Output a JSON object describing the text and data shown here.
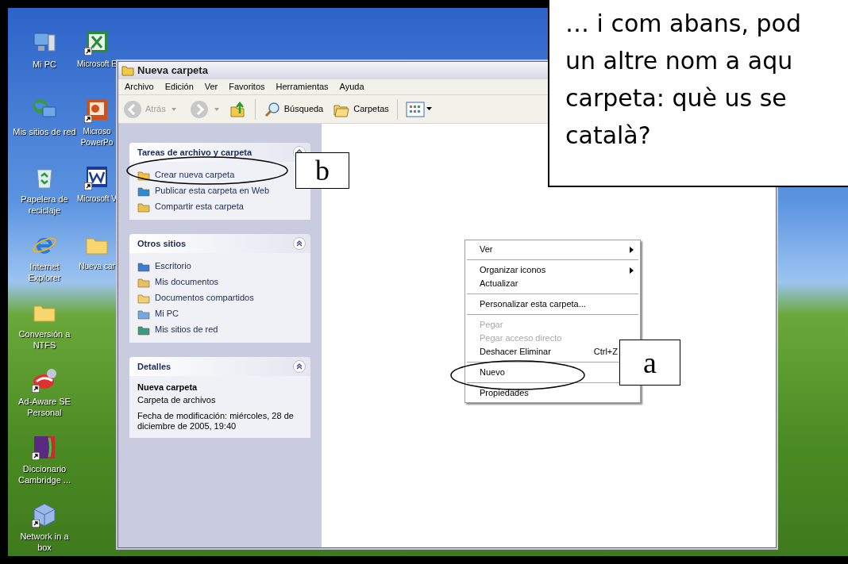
{
  "desktop": {
    "icons_column_1": [
      {
        "label": "Mi PC",
        "shortcut": false
      },
      {
        "label": "Mis sitios de red",
        "shortcut": false
      },
      {
        "label": "Papelera de reciclaje",
        "shortcut": false
      },
      {
        "label": "Internet Explorer",
        "shortcut": false
      },
      {
        "label": "Conversión a NTFS",
        "shortcut": false
      },
      {
        "label": "Ad-Aware SE Personal",
        "shortcut": true
      },
      {
        "label": "Diccionario Cambridge ...",
        "shortcut": true
      },
      {
        "label": "Network in a box",
        "shortcut": true
      }
    ],
    "icons_column_2": [
      {
        "label": "Microsoft E",
        "shortcut": true
      },
      {
        "label": "Microso PowerPo",
        "shortcut": true
      },
      {
        "label": "Microsoft V",
        "shortcut": true
      },
      {
        "label": "Nueva car",
        "shortcut": false
      }
    ]
  },
  "window": {
    "title": "Nueva carpeta",
    "menu": [
      "Archivo",
      "Edición",
      "Ver",
      "Favoritos",
      "Herramientas",
      "Ayuda"
    ],
    "toolbar": {
      "back": {
        "label": "Atrás",
        "disabled": true
      },
      "forward": {
        "disabled": true
      },
      "search": "Búsqueda",
      "folders": "Carpetas"
    },
    "panels": [
      {
        "title": "Tareas de archivo y carpeta",
        "expanded": true,
        "items": [
          "Crear nueva carpeta",
          "Publicar esta carpeta en Web",
          "Compartir esta carpeta"
        ]
      },
      {
        "title": "Otros sitios",
        "expanded": true,
        "items": [
          "Escritorio",
          "Mis documentos",
          "Documentos compartidos",
          "Mi PC",
          "Mis sitios de red"
        ]
      },
      {
        "title": "Detalles",
        "expanded": true,
        "name": "Nueva carpeta",
        "type": "Carpeta de archivos",
        "modified": "Fecha de modificación: miércoles, 28 de diciembre de 2005, 19:40"
      }
    ]
  },
  "context_menu": [
    {
      "kind": "item",
      "label": "Ver",
      "submenu": true,
      "disabled": false
    },
    {
      "kind": "separator"
    },
    {
      "kind": "item",
      "label": "Organizar iconos",
      "submenu": true,
      "disabled": false
    },
    {
      "kind": "item",
      "label": "Actualizar",
      "submenu": false,
      "disabled": false
    },
    {
      "kind": "separator"
    },
    {
      "kind": "item",
      "label": "Personalizar esta carpeta...",
      "submenu": false,
      "disabled": false
    },
    {
      "kind": "separator"
    },
    {
      "kind": "item",
      "label": "Pegar",
      "submenu": false,
      "disabled": true
    },
    {
      "kind": "item",
      "label": "Pegar acceso directo",
      "submenu": false,
      "disabled": true
    },
    {
      "kind": "item",
      "label": "Deshacer Eliminar",
      "shortcut": "Ctrl+Z",
      "disabled": false
    },
    {
      "kind": "separator"
    },
    {
      "kind": "item",
      "label": "Nuevo",
      "disabled": false
    },
    {
      "kind": "separator"
    },
    {
      "kind": "item",
      "label": "Propiedades",
      "submenu": false,
      "disabled": false
    }
  ],
  "annotations": {
    "label_b": "b",
    "label_a": "a",
    "callout_lines": [
      "… i com abans, pod",
      "un altre nom a aqu",
      "carpeta: què us se",
      "català?"
    ]
  }
}
